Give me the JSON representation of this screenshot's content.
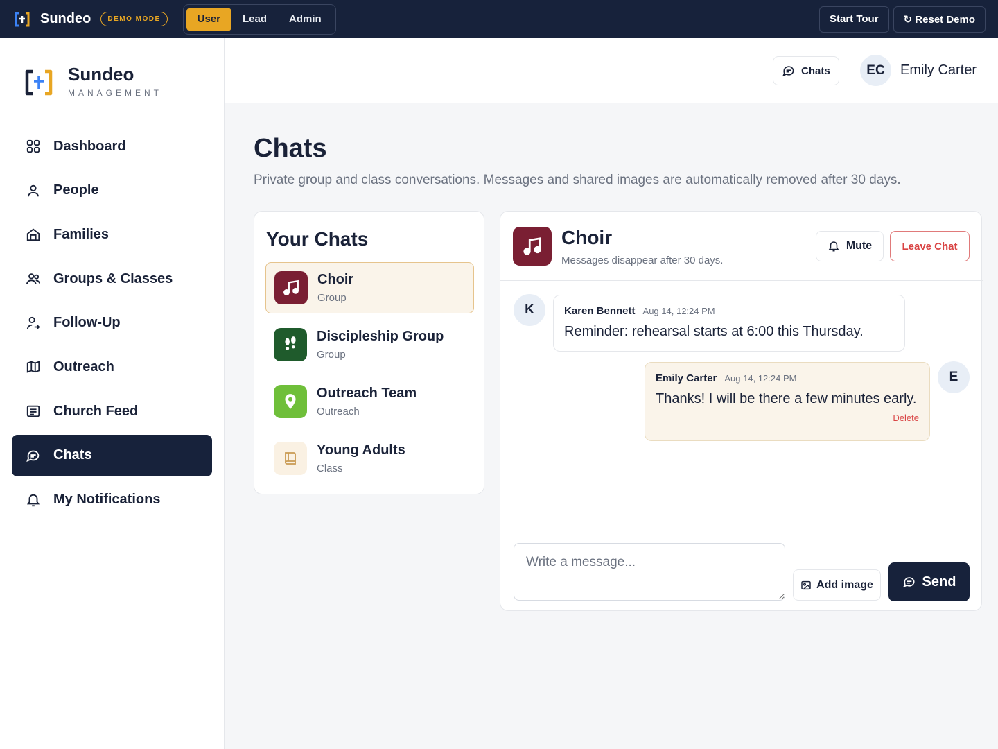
{
  "topbar": {
    "brand": "Sundeo",
    "demo_badge": "DEMO MODE",
    "roles": [
      "User",
      "Lead",
      "Admin"
    ],
    "active_role": "User",
    "start_tour": "Start Tour",
    "reset_demo": "↻ Reset Demo"
  },
  "sidebar": {
    "brand": "Sundeo",
    "brand_sub": "MANAGEMENT",
    "items": [
      {
        "label": "Dashboard",
        "icon": "grid-icon"
      },
      {
        "label": "People",
        "icon": "user-icon"
      },
      {
        "label": "Families",
        "icon": "house-icon"
      },
      {
        "label": "Groups & Classes",
        "icon": "users-icon"
      },
      {
        "label": "Follow-Up",
        "icon": "user-follow-icon"
      },
      {
        "label": "Outreach",
        "icon": "map-icon"
      },
      {
        "label": "Church Feed",
        "icon": "newspaper-icon"
      },
      {
        "label": "Chats",
        "icon": "chat-icon",
        "active": true
      },
      {
        "label": "My Notifications",
        "icon": "bell-icon"
      }
    ]
  },
  "header": {
    "chats_label": "Chats",
    "avatar_initials": "EC",
    "user_name": "Emily Carter"
  },
  "page": {
    "title": "Chats",
    "description": "Private group and class conversations. Messages and shared images are automatically removed after 30 days."
  },
  "chat_list": {
    "title": "Your Chats",
    "items": [
      {
        "name": "Choir",
        "type": "Group",
        "color": "#7a1f33",
        "icon": "music-note-icon",
        "active": true
      },
      {
        "name": "Discipleship Group",
        "type": "Group",
        "color": "#1f5b2c",
        "icon": "footprints-icon"
      },
      {
        "name": "Outreach Team",
        "type": "Outreach",
        "color": "#6fbf3a",
        "icon": "map-pin-icon"
      },
      {
        "name": "Young Adults",
        "type": "Class",
        "color": "#faf1e3",
        "icon": "book-icon"
      }
    ]
  },
  "conversation": {
    "name": "Choir",
    "subtitle": "Messages disappear after 30 days.",
    "mute_label": "Mute",
    "leave_label": "Leave Chat",
    "messages": [
      {
        "initial": "K",
        "author": "Karen Bennett",
        "time": "Aug 14, 12:24 PM",
        "text": "Reminder: rehearsal starts at 6:00 this Thursday.",
        "mine": false
      },
      {
        "initial": "E",
        "author": "Emily Carter",
        "time": "Aug 14, 12:24 PM",
        "text": "Thanks! I will be there a few minutes early.",
        "mine": true,
        "delete_label": "Delete"
      }
    ],
    "compose": {
      "placeholder": "Write a message...",
      "add_image_label": "Add image",
      "send_label": "Send"
    }
  },
  "colors": {
    "navy": "#17223b",
    "accent": "#e8a623",
    "danger": "#d94444"
  }
}
